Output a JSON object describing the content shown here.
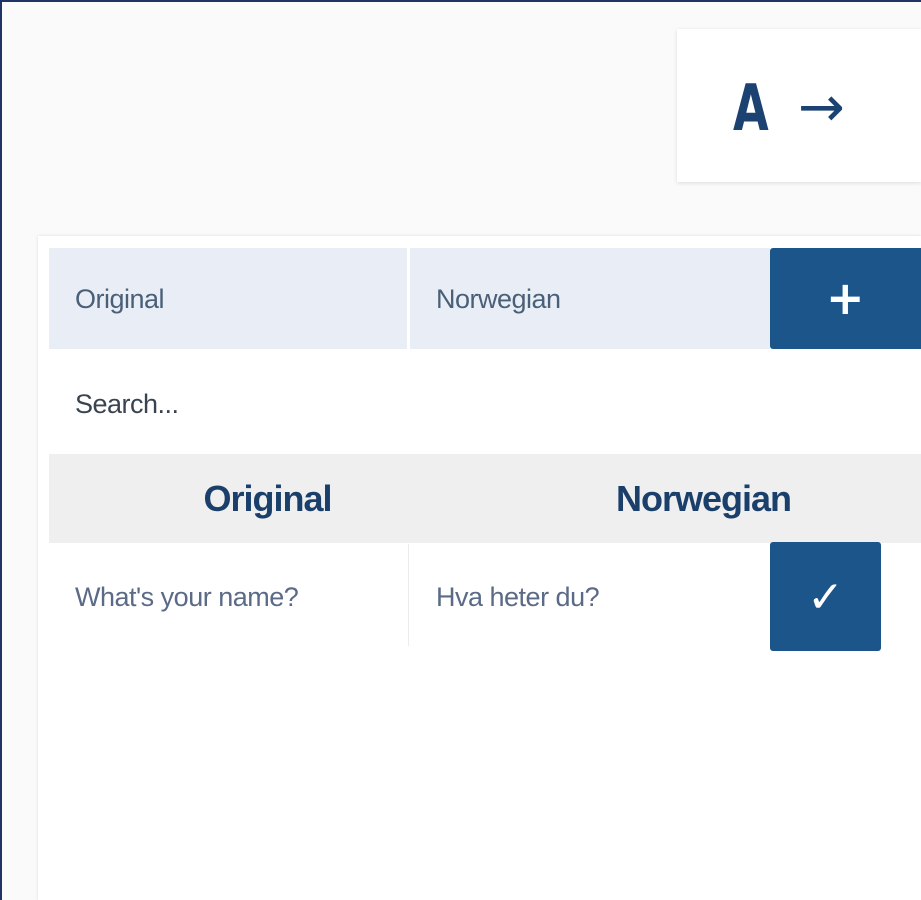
{
  "logo": {
    "letter": "A",
    "arrow": "→"
  },
  "add_form": {
    "original_placeholder": "Original",
    "target_placeholder": "Norwegian",
    "add_label": "+"
  },
  "search": {
    "placeholder": "Search..."
  },
  "table": {
    "columns": [
      "Original",
      "Norwegian"
    ],
    "rows": [
      {
        "original": "What's your name?",
        "translation": "Hva heter du?",
        "action_label": "✓"
      }
    ]
  },
  "colors": {
    "accent": "#1b5589",
    "frame_border": "#1e3466",
    "input_bg": "#e9eef6",
    "header_bg": "#efefef",
    "heading_text": "#1b3f6b"
  }
}
